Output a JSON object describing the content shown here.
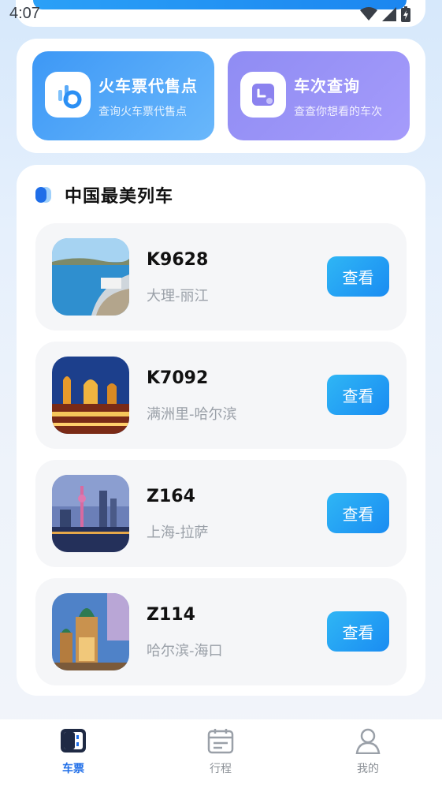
{
  "status": {
    "time": "4:07"
  },
  "shortcuts": [
    {
      "title": "火车票代售点",
      "subtitle": "查询火车票代售点",
      "icon": "pie-chart-icon"
    },
    {
      "title": "车次查询",
      "subtitle": "查查你想看的车次",
      "icon": "clock-icon"
    }
  ],
  "section": {
    "title": "中国最美列车"
  },
  "trains": [
    {
      "code": "K9628",
      "route": "大理-丽江",
      "action": "查看"
    },
    {
      "code": "K7092",
      "route": "满洲里-哈尔滨",
      "action": "查看"
    },
    {
      "code": "Z164",
      "route": "上海-拉萨",
      "action": "查看"
    },
    {
      "code": "Z114",
      "route": "哈尔滨-海口",
      "action": "查看"
    }
  ],
  "tabs": [
    {
      "label": "车票",
      "icon": "ticket-icon",
      "active": true
    },
    {
      "label": "行程",
      "icon": "calendar-icon",
      "active": false
    },
    {
      "label": "我的",
      "icon": "user-icon",
      "active": false
    }
  ],
  "colors": {
    "accent": "#1f6ee8",
    "button": "#1a8cf2",
    "tile1": "#3d98f6",
    "tile2": "#8f8cf3"
  }
}
